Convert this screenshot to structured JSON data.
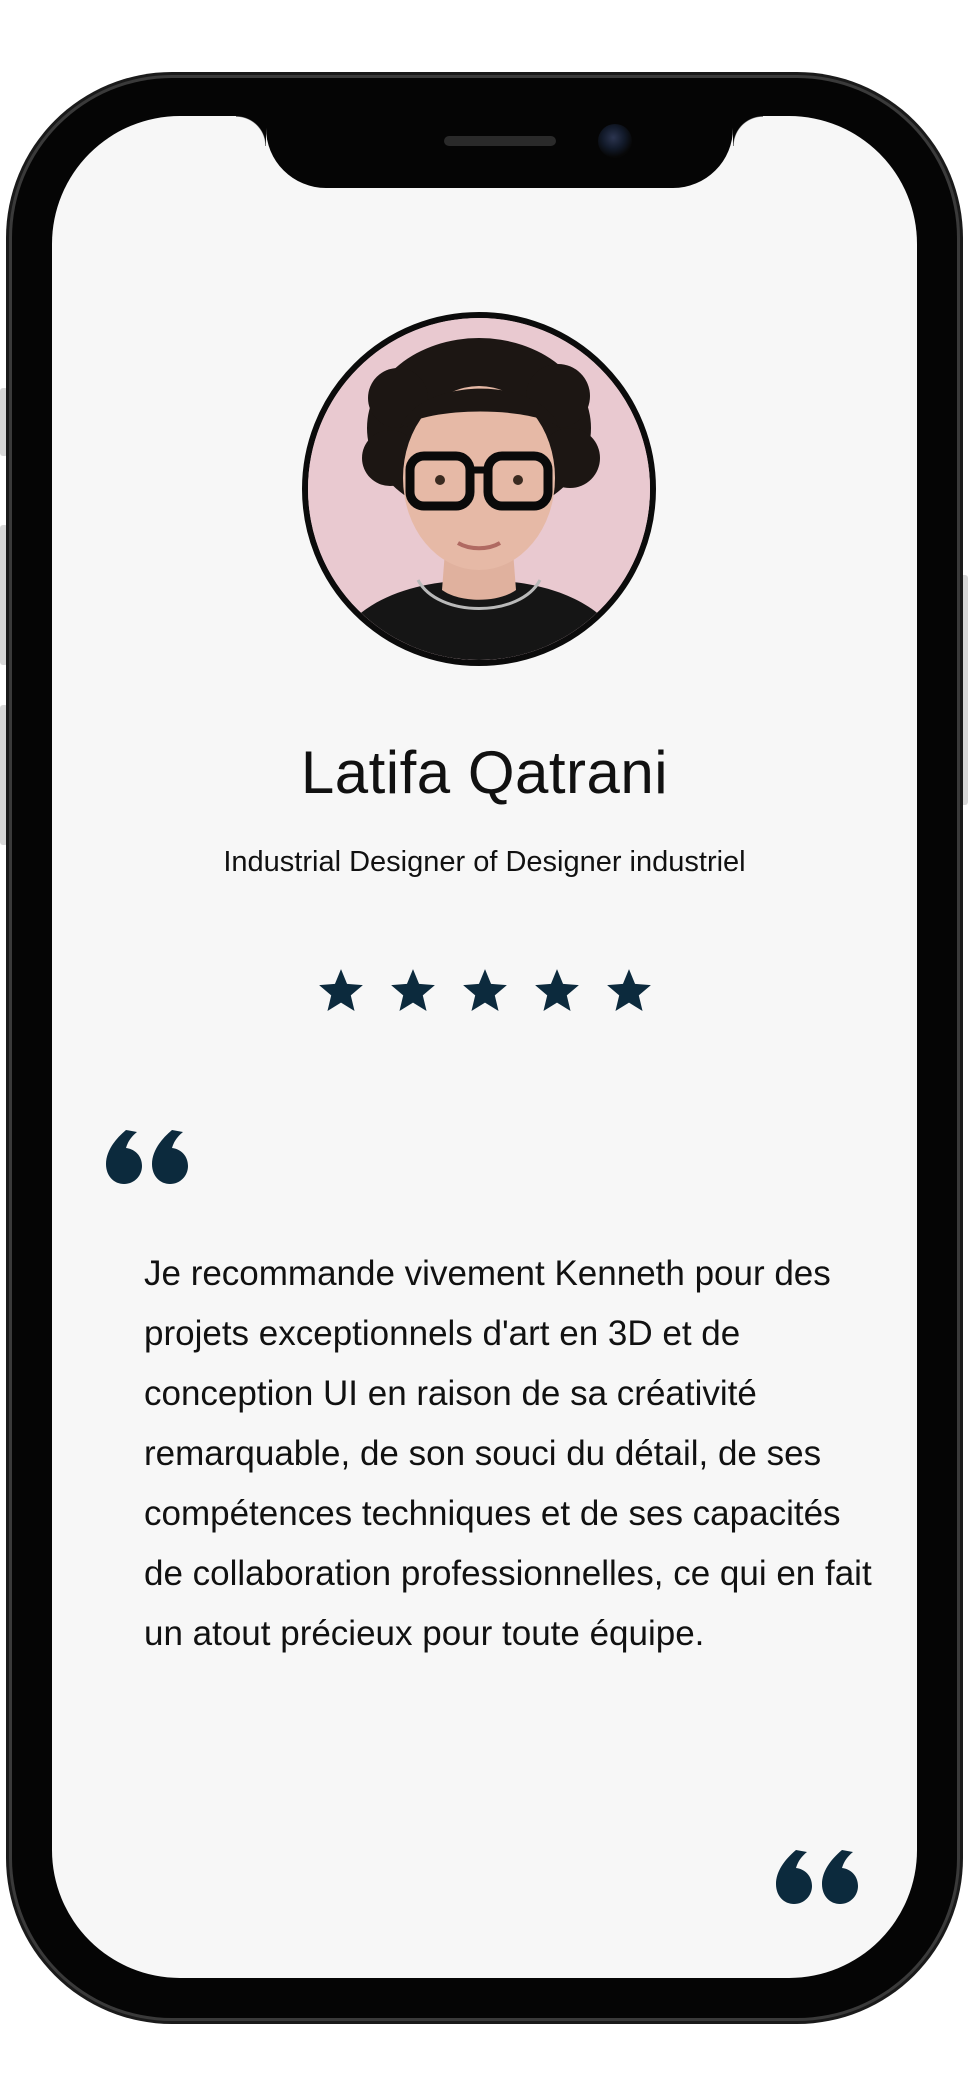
{
  "profile": {
    "name": "Latifa Qatrani",
    "title": "Industrial Designer of Designer industriel",
    "rating": 5,
    "rating_max": 5
  },
  "testimonial": {
    "text": "Je recommande vivement Kenneth pour des projets exceptionnels d'art en 3D et de conception UI en raison de sa créativité remarquable, de son souci du détail, de ses compétences techniques et de ses capacités de collaboration professionnelles, ce qui en fait un atout précieux pour toute équipe."
  },
  "icons": {
    "star": "star-icon",
    "quote_open": "quote-open-icon",
    "quote_close": "quote-close-icon"
  },
  "colors": {
    "accent": "#0c2a3d",
    "screen_bg": "#f7f7f7",
    "avatar_bg": "#e9c9d0",
    "text": "#111111"
  }
}
